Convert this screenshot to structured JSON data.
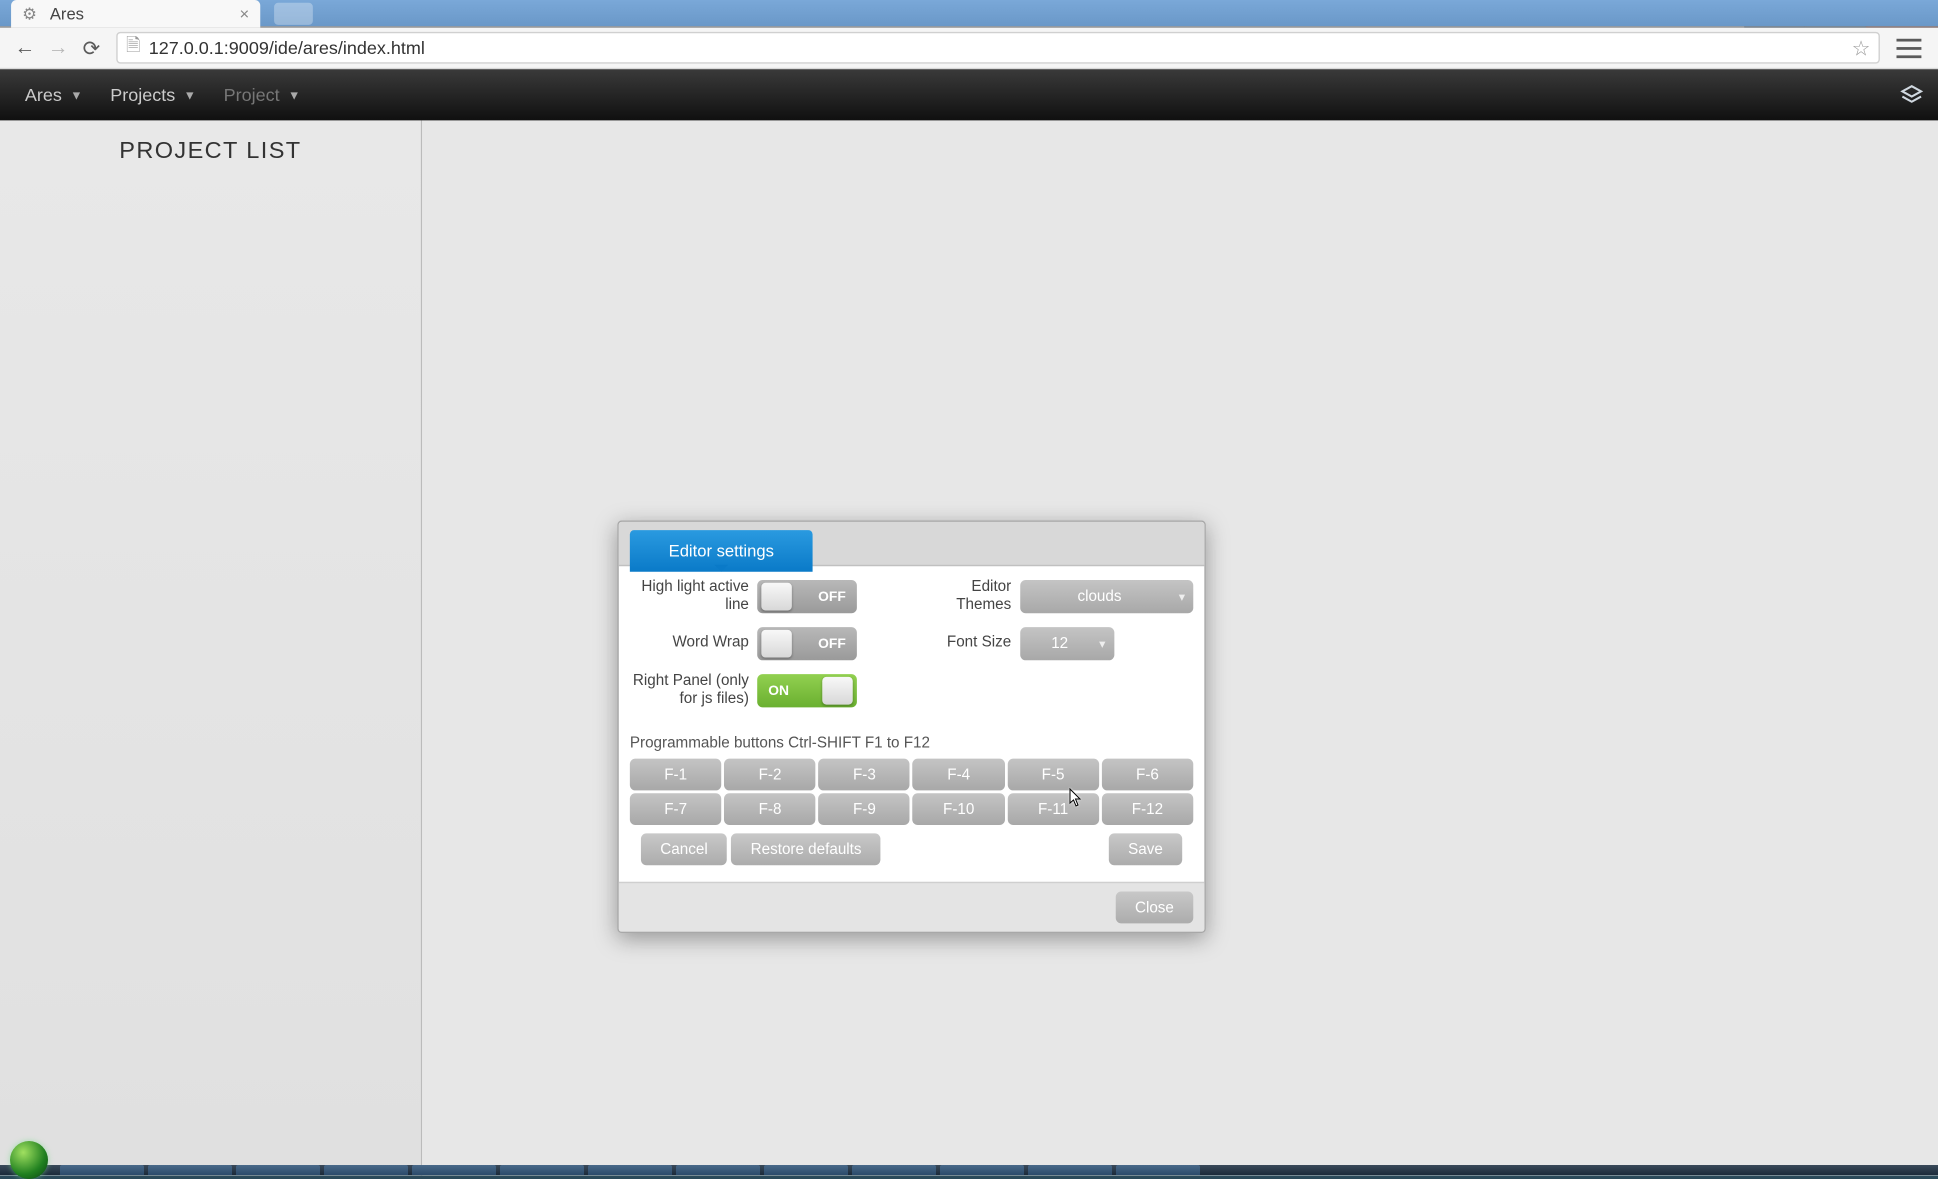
{
  "browser": {
    "tab_title": "Ares",
    "url": "127.0.0.1:9009/ide/ares/index.html"
  },
  "menubar": {
    "items": [
      {
        "label": "Ares",
        "disabled": false
      },
      {
        "label": "Projects",
        "disabled": false
      },
      {
        "label": "Project",
        "disabled": true
      }
    ]
  },
  "sidebar": {
    "title": "PROJECT LIST"
  },
  "dialog": {
    "tab_label": "Editor settings",
    "settings": {
      "highlight_label": "High light active line",
      "highlight_state": "OFF",
      "wordwrap_label": "Word Wrap",
      "wordwrap_state": "OFF",
      "rightpanel_label": "Right Panel (only for js files)",
      "rightpanel_state": "ON",
      "themes_label": "Editor Themes",
      "themes_value": "clouds",
      "fontsize_label": "Font Size",
      "fontsize_value": "12"
    },
    "programmable_label": "Programmable buttons Ctrl-SHIFT F1 to F12",
    "fkeys": [
      "F-1",
      "F-2",
      "F-3",
      "F-4",
      "F-5",
      "F-6",
      "F-7",
      "F-8",
      "F-9",
      "F-10",
      "F-11",
      "F-12"
    ],
    "actions": {
      "cancel": "Cancel",
      "restore": "Restore defaults",
      "save": "Save",
      "close": "Close"
    }
  }
}
